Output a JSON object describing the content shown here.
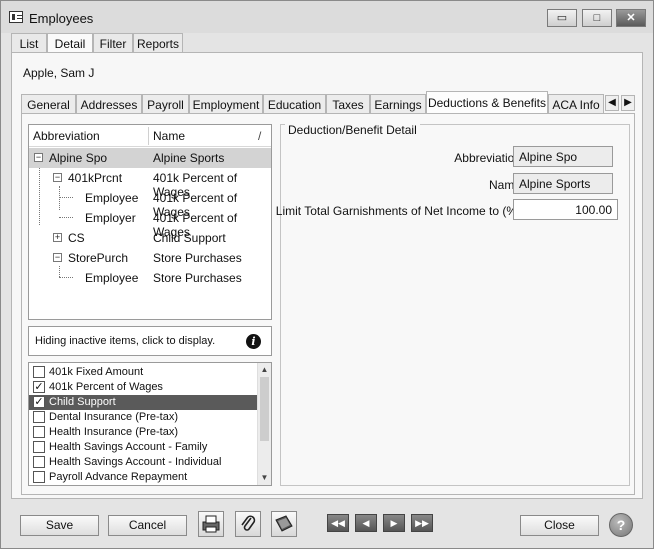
{
  "window": {
    "title": "Employees",
    "controls": {
      "minimize": "▭",
      "maximize": "□",
      "close": "✕"
    }
  },
  "top_tabs": [
    "List",
    "Detail",
    "Filter",
    "Reports"
  ],
  "employee_name": "Apple, Sam J",
  "sub_tabs": [
    "General",
    "Addresses",
    "Payroll",
    "Employment",
    "Education",
    "Taxes",
    "Earnings",
    "Deductions & Benefits",
    "ACA Info"
  ],
  "tree": {
    "columns": {
      "abbreviation": "Abbreviation",
      "name": "Name",
      "sort": "/"
    },
    "rows": [
      {
        "abbr": "Alpine Spo",
        "name": "Alpine Sports"
      },
      {
        "abbr": "401kPrcnt",
        "name": "401k Percent of Wages"
      },
      {
        "abbr": "Employee",
        "name": "401k Percent of Wages"
      },
      {
        "abbr": "Employer",
        "name": "401k Percent of Wages"
      },
      {
        "abbr": "CS",
        "name": "Child Support"
      },
      {
        "abbr": "StorePurch",
        "name": "Store Purchases"
      },
      {
        "abbr": "Employee",
        "name": "Store Purchases"
      }
    ]
  },
  "info": {
    "text": "Hiding inactive items, click to display.",
    "icon": "i"
  },
  "checklist": [
    {
      "label": "401k Fixed Amount",
      "mark": ""
    },
    {
      "label": "401k Percent of Wages",
      "mark": "✓"
    },
    {
      "label": "Child Support",
      "mark": "✓"
    },
    {
      "label": "Dental Insurance (Pre-tax)",
      "mark": ""
    },
    {
      "label": "Health Insurance (Pre-tax)",
      "mark": ""
    },
    {
      "label": "Health Savings Account - Family",
      "mark": ""
    },
    {
      "label": "Health Savings Account - Individual",
      "mark": ""
    },
    {
      "label": "Payroll Advance Repayment",
      "mark": ""
    }
  ],
  "detail": {
    "legend": "Deduction/Benefit Detail",
    "abbreviation_label": "Abbreviation",
    "abbreviation_value": "Alpine Spo",
    "name_label": "Name",
    "name_value": "Alpine Sports",
    "limit_label": "Limit Total Garnishments of Net Income to (%)",
    "limit_value": "100.00"
  },
  "footer": {
    "save": "Save",
    "cancel": "Cancel",
    "close": "Close",
    "help": "?",
    "nav": {
      "first": "◀◀",
      "prev": "◀",
      "next": "▶",
      "last": "▶▶"
    }
  }
}
